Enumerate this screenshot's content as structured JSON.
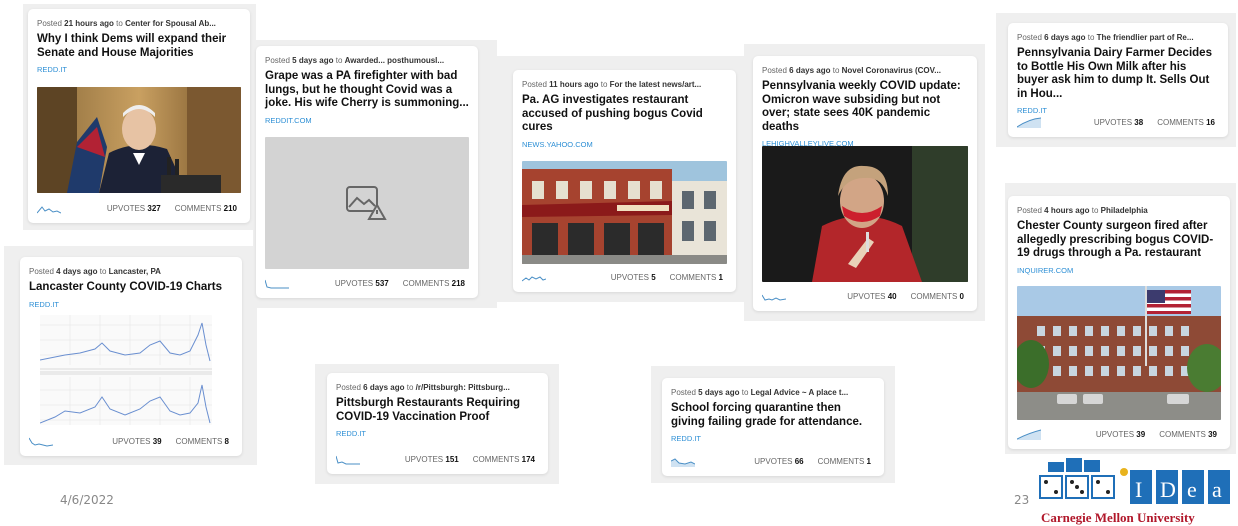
{
  "slide": {
    "date": "4/6/2022",
    "page_number": "23",
    "institution": "Carnegie Mellon University",
    "logo_text": "CASOS IDeaS"
  },
  "labels": {
    "posted": "Posted",
    "to": "to",
    "upvotes": "UPVOTES",
    "comments": "COMMENTS"
  },
  "colors": {
    "link_blue": "#2d8fd5",
    "cmu_red": "#b1182b",
    "spark_blue": "#4a8fc6"
  },
  "posts": [
    {
      "time": "21 hours ago",
      "community": "Center for Spousal Ab...",
      "title": "Why I think Dems will expand their Senate and House Majorities",
      "domain": "REDD.IT",
      "upvotes": "327",
      "comments": "210",
      "thumb": "biden-press-conference-photo"
    },
    {
      "time": "5 days ago",
      "community": "Awarded... posthumousl...",
      "title": "Grape was a PA firefighter with bad lungs, but he thought Covid was a joke. His wife Cherry is summoning...",
      "domain": "REDDIT.COM",
      "upvotes": "537",
      "comments": "218",
      "thumb": "broken-image-icon"
    },
    {
      "time": "11 hours ago",
      "community": "For the latest news/art...",
      "title": "Pa. AG investigates restaurant accused of pushing bogus Covid cures",
      "domain": "NEWS.YAHOO.COM",
      "upvotes": "5",
      "comments": "1",
      "thumb": "restaurant-storefront-photo"
    },
    {
      "time": "6 days ago",
      "community": "Novel Coronavirus (COV...",
      "title": "Pennsylvania weekly COVID update: Omicron wave subsiding but not over; state sees 40K pandemic deaths",
      "domain": "LEHIGHVALLEYLIVE.COM",
      "upvotes": "40",
      "comments": "0",
      "thumb": "health-worker-mask-photo"
    },
    {
      "time": "6 days ago",
      "community": "The friendlier part of Re...",
      "title": "Pennsylvania Dairy Farmer Decides to Bottle His Own Milk after his buyer ask him to dump It. Sells Out in Hou...",
      "domain": "REDD.IT",
      "upvotes": "38",
      "comments": "16",
      "thumb": ""
    },
    {
      "time": "4 days ago",
      "community": "Lancaster, PA",
      "title": "Lancaster County COVID-19 Charts",
      "domain": "REDD.IT",
      "upvotes": "39",
      "comments": "8",
      "thumb": "covid-line-charts-image"
    },
    {
      "time": "6 days ago",
      "community": "/r/Pittsburgh: Pittsburg...",
      "title": "Pittsburgh Restaurants Requiring COVID-19 Vaccination Proof",
      "domain": "REDD.IT",
      "upvotes": "151",
      "comments": "174",
      "thumb": ""
    },
    {
      "time": "5 days ago",
      "community": "Legal Advice ~ A place t...",
      "title": "School forcing quarantine then giving failing grade for attendance.",
      "domain": "REDD.IT",
      "upvotes": "66",
      "comments": "1",
      "thumb": ""
    },
    {
      "time": "4 hours ago",
      "community": "Philadelphia",
      "title": "Chester County surgeon fired after allegedly prescribing bogus COVID-19 drugs through a Pa. restaurant",
      "domain": "INQUIRER.COM",
      "upvotes": "39",
      "comments": "39",
      "thumb": "brick-building-flag-photo"
    }
  ]
}
